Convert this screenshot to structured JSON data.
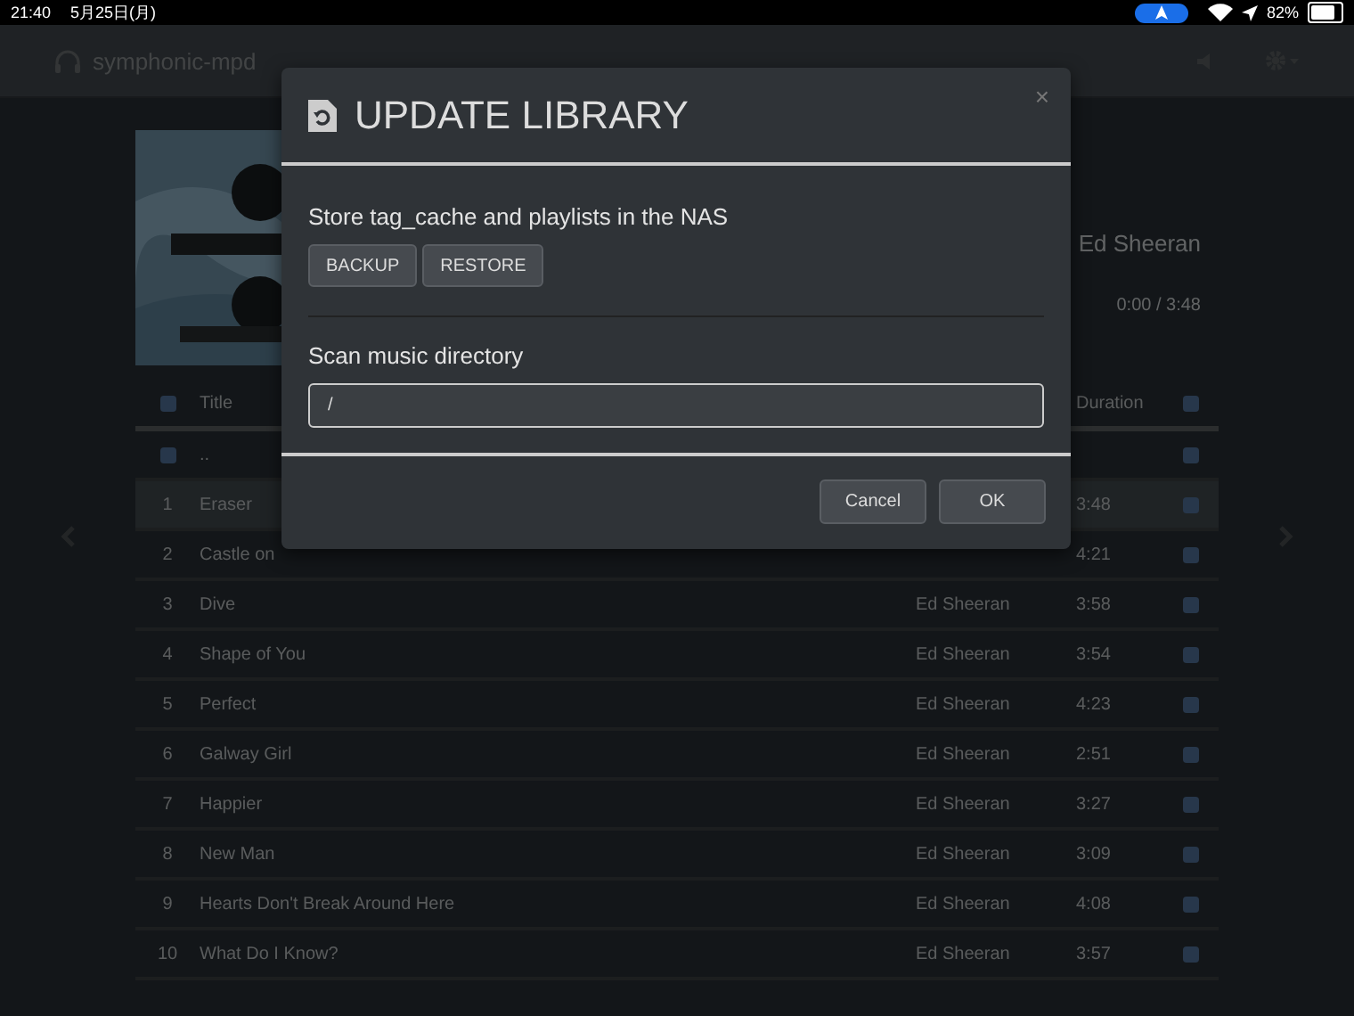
{
  "status_bar": {
    "time": "21:40",
    "date": "5月25日(月)",
    "battery": "82%"
  },
  "navbar": {
    "brand": "symphonic-mpd"
  },
  "now_playing": {
    "artist": "Ed Sheeran",
    "time": "0:00 / 3:48"
  },
  "playlist": {
    "columns": [
      "Title",
      "Duration"
    ],
    "parent_row": "..",
    "rows": [
      {
        "number": "1",
        "title": "Eraser",
        "duration": "3:48",
        "selected": true
      },
      {
        "number": "2",
        "title": "Castle on",
        "duration": "4:21",
        "selected": false
      },
      {
        "number": "3",
        "title": "Dive",
        "artist": "Ed Sheeran",
        "duration": "3:58",
        "selected": false
      },
      {
        "number": "4",
        "title": "Shape of You",
        "artist": "Ed Sheeran",
        "duration": "3:54",
        "selected": false
      },
      {
        "number": "5",
        "title": "Perfect",
        "artist": "Ed Sheeran",
        "duration": "4:23",
        "selected": false
      },
      {
        "number": "6",
        "title": "Galway Girl",
        "artist": "Ed Sheeran",
        "duration": "2:51",
        "selected": false
      },
      {
        "number": "7",
        "title": "Happier",
        "artist": "Ed Sheeran",
        "duration": "3:27",
        "selected": false
      },
      {
        "number": "8",
        "title": "New Man",
        "artist": "Ed Sheeran",
        "duration": "3:09",
        "selected": false
      },
      {
        "number": "9",
        "title": "Hearts Don't Break Around Here",
        "artist": "Ed Sheeran",
        "duration": "4:08",
        "selected": false
      },
      {
        "number": "10",
        "title": "What Do I Know?",
        "artist": "Ed Sheeran",
        "duration": "3:57",
        "selected": false
      }
    ]
  },
  "dialog": {
    "title": "UPDATE LIBRARY",
    "close": "×",
    "backup_label": "Store tag_cache and playlists in the NAS",
    "backup_buttons": [
      "BACKUP",
      "RESTORE"
    ],
    "scan_label": "Scan music directory",
    "scan_value": "/",
    "footer_buttons": [
      "Cancel",
      "OK"
    ]
  }
}
